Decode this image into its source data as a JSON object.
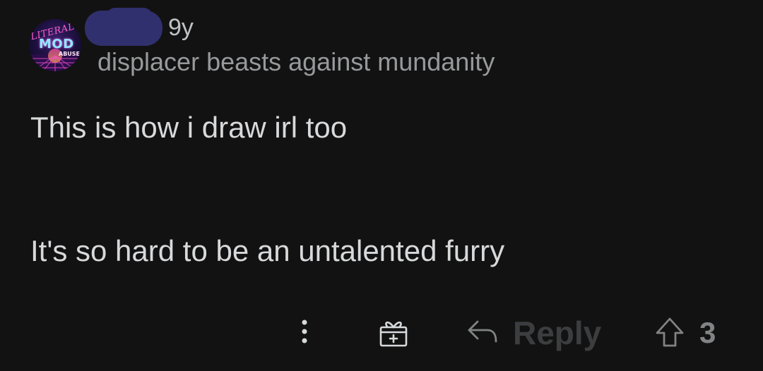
{
  "comment": {
    "avatar": {
      "name": "literal-mod-abuse-avatar",
      "text_lines": [
        "LITERAL",
        "MOD",
        "ABUSE"
      ]
    },
    "timestamp": "9y",
    "user_flair": "displacer beasts against mundanity",
    "body": [
      "This is how i draw irl too",
      "It's so hard to be an untalented furry"
    ]
  },
  "actions": {
    "more_icon": "vertical-ellipsis-icon",
    "award_icon": "gift-icon",
    "reply_icon": "reply-arrow-icon",
    "reply_label": "Reply",
    "upvote_icon": "upvote-arrow-icon",
    "vote_count": "3"
  },
  "colors": {
    "background": "#121212",
    "body_text": "#d8d9db",
    "muted_text": "#98999b",
    "redaction": "#30306e"
  }
}
